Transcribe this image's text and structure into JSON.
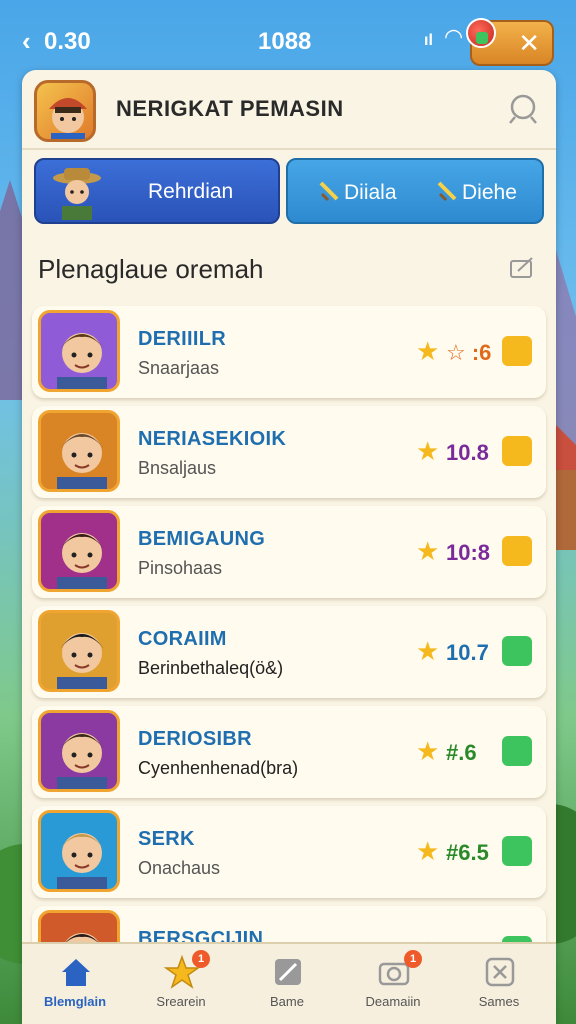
{
  "status_bar": {
    "time_left": "0.30",
    "time_center": "1088"
  },
  "header": {
    "title": "NERIGKAT PEMASIN"
  },
  "tabs": [
    {
      "label": "Rehrdian"
    },
    {
      "label": "Diiala"
    },
    {
      "label": "Diehe"
    }
  ],
  "section": {
    "title": "Plenaglaue oremah"
  },
  "players": [
    {
      "name": "DERIIILR",
      "subtitle": "Snaarjaas",
      "score": "☆ :6",
      "score_color": "#e06a1a",
      "badge_color": "#f6b91d"
    },
    {
      "name": "NERIASEKIOIK",
      "subtitle": "Bnsaljaus",
      "score": "10.8",
      "score_color": "#7a2a9a",
      "badge_color": "#f6b91d"
    },
    {
      "name": "BEMIGAUNG",
      "subtitle": "Pinsohaas",
      "score": "10:8",
      "score_color": "#7a2a9a",
      "badge_color": "#f6b91d"
    },
    {
      "name": "CORAIIM",
      "subtitle": "Berinbethaleq(ö&)",
      "score": "10.7",
      "score_color": "#1f6fb0",
      "badge_color": "#3ec45e"
    },
    {
      "name": "DERIOSIBR",
      "subtitle": "Cyenhenhenad(bra)",
      "score": "#.6",
      "score_color": "#2a8a2a",
      "badge_color": "#3ec45e"
    },
    {
      "name": "SERK",
      "subtitle": "Onachaus",
      "score": "#6.5",
      "score_color": "#2a8a2a",
      "badge_color": "#3ec45e"
    },
    {
      "name": "BERSGCIJIN",
      "subtitle": "",
      "score": "",
      "score_color": "#2a8a2a",
      "badge_color": "#3ec45e"
    }
  ],
  "bottom_nav": [
    {
      "label": "Blemglain",
      "icon": "home-icon",
      "badge": ""
    },
    {
      "label": "Srearein",
      "icon": "star-icon",
      "badge": "1"
    },
    {
      "label": "Bame",
      "icon": "pencil-icon",
      "badge": ""
    },
    {
      "label": "Deamaiin",
      "icon": "camera-icon",
      "badge": "1"
    },
    {
      "label": "Sames",
      "icon": "shield-icon",
      "badge": ""
    }
  ]
}
